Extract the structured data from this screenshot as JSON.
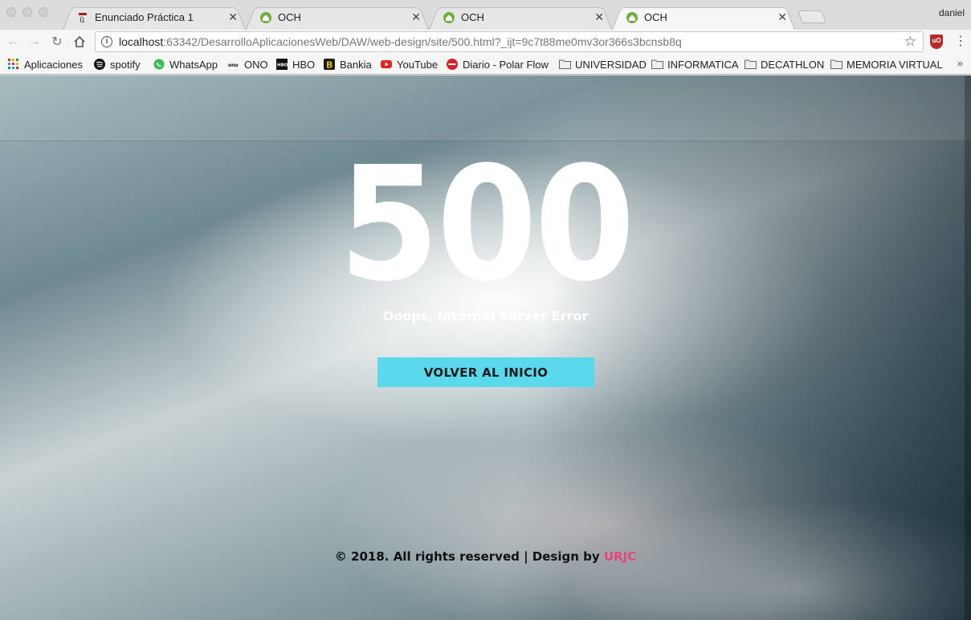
{
  "browser": {
    "profile_name": "daniel",
    "tabs": [
      {
        "title": "Enunciado Práctica 1",
        "active": false,
        "favicon": "university-icon"
      },
      {
        "title": "OCH",
        "active": false,
        "favicon": "home-icon"
      },
      {
        "title": "OCH",
        "active": false,
        "favicon": "home-icon"
      },
      {
        "title": "OCH",
        "active": true,
        "favicon": "home-icon"
      }
    ],
    "url_host": "localhost",
    "url_rest": ":63342/DesarrolloAplicacionesWeb/DAW/web-design/site/500.html?_ijt=9c7t88me0mv3or366s3bcnsb8q",
    "bookmarks": [
      {
        "label": "Aplicaciones",
        "icon": "apps-grid-icon"
      },
      {
        "label": "spotify",
        "icon": "spotify-icon"
      },
      {
        "label": "WhatsApp",
        "icon": "whatsapp-icon"
      },
      {
        "label": "ONO",
        "icon": "ono-icon"
      },
      {
        "label": "HBO",
        "icon": "hbo-icon"
      },
      {
        "label": "Bankia",
        "icon": "bankia-icon"
      },
      {
        "label": "YouTube",
        "icon": "youtube-icon"
      },
      {
        "label": "Diario - Polar Flow",
        "icon": "polar-icon"
      },
      {
        "label": "UNIVERSIDAD",
        "icon": "folder-icon"
      },
      {
        "label": "INFORMATICA",
        "icon": "folder-icon"
      },
      {
        "label": "DECATHLON",
        "icon": "folder-icon"
      },
      {
        "label": "MEMORIA VIRTUAL",
        "icon": "folder-icon"
      }
    ],
    "overflow_label": "»"
  },
  "page": {
    "error_code": "500",
    "error_message": "Ooops, Internal Server Error",
    "home_button_label": "VOLVER AL INICIO",
    "footer_text": "© 2018. All rights reserved | Design by ",
    "footer_brand": "URJC",
    "brand_color": "#e8457c",
    "button_color": "#5ad8ec"
  }
}
